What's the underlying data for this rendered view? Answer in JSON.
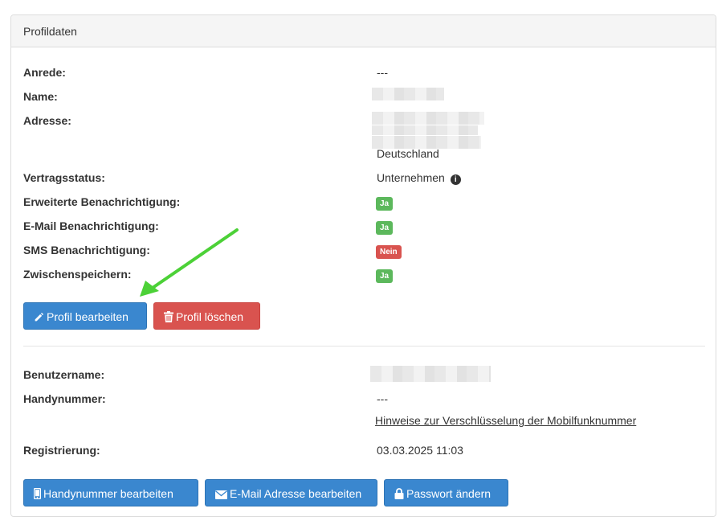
{
  "panel": {
    "title": "Profildaten"
  },
  "profile": {
    "anrede_label": "Anrede:",
    "anrede_value": "---",
    "name_label": "Name:",
    "adresse_label": "Adresse:",
    "adresse_country": "Deutschland",
    "vertrag_label": "Vertragsstatus:",
    "vertrag_value": "Unternehmen",
    "erw_label": "Erweiterte Benachrichtigung:",
    "erw_value": "Ja",
    "email_label": "E-Mail Benachrichtigung:",
    "email_value": "Ja",
    "sms_label": "SMS Benachrichtigung:",
    "sms_value": "Nein",
    "zw_label": "Zwischenspeichern:",
    "zw_value": "Ja"
  },
  "buttons": {
    "edit_profile": "Profil bearbeiten",
    "delete_profile": "Profil löschen",
    "edit_phone": "Handynummer bearbeiten",
    "edit_email": "E-Mail Adresse bearbeiten",
    "change_password": "Passwort ändern"
  },
  "account": {
    "username_label": "Benutzername:",
    "phone_label": "Handynummer:",
    "phone_value": "---",
    "phone_hint_link": "Hinweise zur Verschlüsselung der Mobilfunknummer",
    "registration_label": "Registrierung:",
    "registration_value": "03.03.2025 11:03"
  },
  "icons": {
    "info": "info-circle-icon",
    "pencil": "pencil-icon",
    "trash": "trash-icon",
    "mobile": "mobile-icon",
    "envelope": "envelope-icon",
    "lock": "lock-icon"
  },
  "colors": {
    "primary": "#3a87cf",
    "danger": "#d9534f",
    "success": "#5cb85c",
    "annotation_arrow": "#4cd137"
  }
}
